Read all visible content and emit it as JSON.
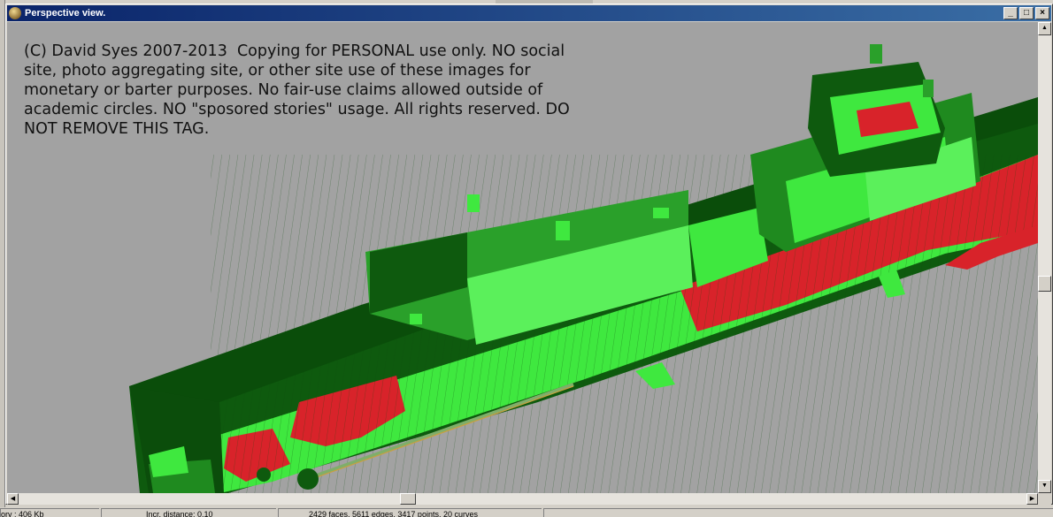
{
  "window": {
    "title": "Perspective view.",
    "controls": {
      "minimize": "_",
      "maximize": "□",
      "close": "×"
    }
  },
  "viewport": {
    "background_color": "#a2a2a2",
    "copyright_text": "(C) David Syes 2007-2013  Copying for PERSONAL use only. NO social site, photo aggregating site, or other site use of these images for monetary or barter purposes. No fair-use claims allowed outside of academic circles. NO \"sposored stories\" usage. All rights reserved. DO NOT REMOVE THIS TAG.",
    "model_colors": {
      "dark_green": "#0e5a0e",
      "light_green": "#3fe83f",
      "red": "#d8232a",
      "mid_green": "#1f8a1f"
    }
  },
  "statusbar": {
    "memory": "ory : 406 Kb",
    "increment": "Incr. distance: 0.10",
    "stats": "2429 faces, 5611 edges, 3417 points, 20 curves"
  }
}
